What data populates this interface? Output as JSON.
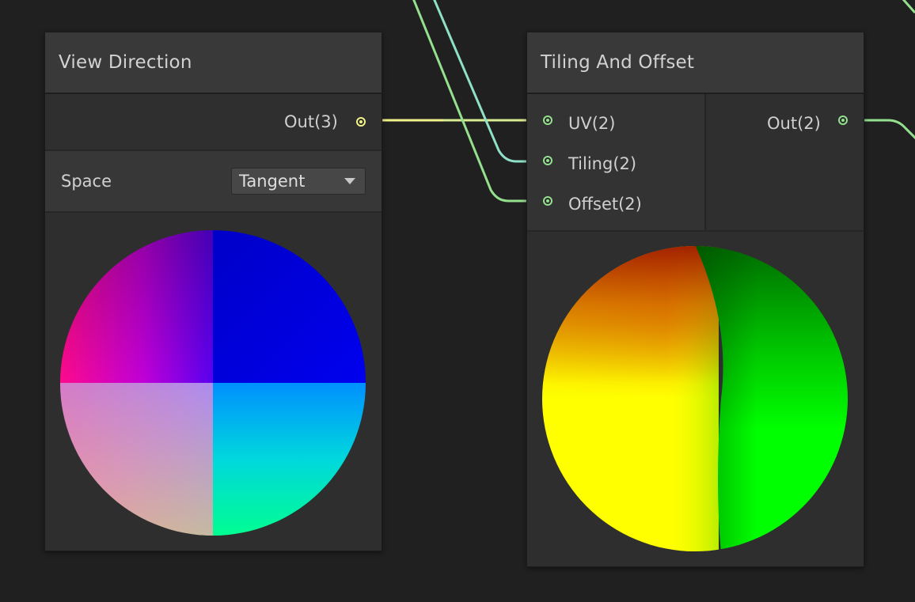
{
  "colors": {
    "background": "#202020",
    "node_body": "#2e2e2e",
    "node_header": "#393939",
    "wire_vector3": "#f2f28a",
    "wire_vector2": "#94e08e",
    "wire_teal": "#8fe0c8"
  },
  "view_direction": {
    "title": "View Direction",
    "output": "Out(3)",
    "space_label": "Space",
    "space_value": "Tangent",
    "preview": "view-direction-preview"
  },
  "tiling_and_offset": {
    "title": "Tiling And Offset",
    "inputs": [
      "UV(2)",
      "Tiling(2)",
      "Offset(2)"
    ],
    "output": "Out(2)",
    "preview": "tiling-offset-preview"
  }
}
